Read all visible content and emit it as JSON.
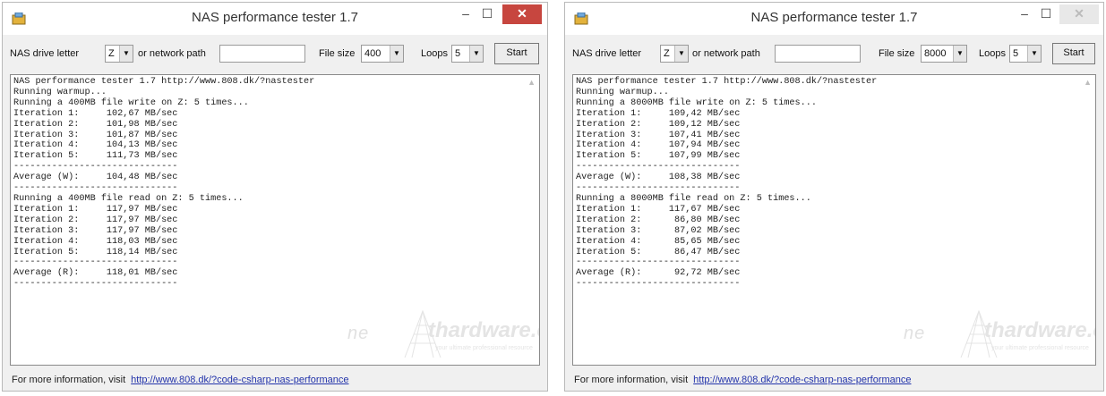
{
  "windows": [
    {
      "title": "NAS performance tester 1.7",
      "controls": {
        "minimize": "–",
        "maximize": "☐",
        "close": "✕"
      },
      "toolbar": {
        "drive_label": "NAS drive letter",
        "drive_value": "Z",
        "network_label": "or network path",
        "network_value": "",
        "filesize_label": "File size",
        "filesize_value": "400",
        "loops_label": "Loops",
        "loops_value": "5",
        "start_label": "Start"
      },
      "output": "NAS performance tester 1.7 http://www.808.dk/?nastester\nRunning warmup...\nRunning a 400MB file write on Z: 5 times...\nIteration 1:     102,67 MB/sec\nIteration 2:     101,98 MB/sec\nIteration 3:     101,87 MB/sec\nIteration 4:     104,13 MB/sec\nIteration 5:     111,73 MB/sec\n------------------------------\nAverage (W):     104,48 MB/sec\n------------------------------\nRunning a 400MB file read on Z: 5 times...\nIteration 1:     117,97 MB/sec\nIteration 2:     117,97 MB/sec\nIteration 3:     117,97 MB/sec\nIteration 4:     118,03 MB/sec\nIteration 5:     118,14 MB/sec\n------------------------------\nAverage (R):     118,01 MB/sec\n------------------------------",
      "footer": {
        "text": "For more information, visit",
        "link": "http://www.808.dk/?code-csharp-nas-performance"
      }
    },
    {
      "title": "NAS performance tester 1.7",
      "controls": {
        "minimize": "–",
        "maximize": "☐",
        "close": "✕"
      },
      "toolbar": {
        "drive_label": "NAS drive letter",
        "drive_value": "Z",
        "network_label": "or network path",
        "network_value": "",
        "filesize_label": "File size",
        "filesize_value": "8000",
        "loops_label": "Loops",
        "loops_value": "5",
        "start_label": "Start"
      },
      "output": "NAS performance tester 1.7 http://www.808.dk/?nastester\nRunning warmup...\nRunning a 8000MB file write on Z: 5 times...\nIteration 1:     109,42 MB/sec\nIteration 2:     109,12 MB/sec\nIteration 3:     107,41 MB/sec\nIteration 4:     107,94 MB/sec\nIteration 5:     107,99 MB/sec\n------------------------------\nAverage (W):     108,38 MB/sec\n------------------------------\nRunning a 8000MB file read on Z: 5 times...\nIteration 1:     117,67 MB/sec\nIteration 2:      86,80 MB/sec\nIteration 3:      87,02 MB/sec\nIteration 4:      85,65 MB/sec\nIteration 5:      86,47 MB/sec\n------------------------------\nAverage (R):      92,72 MB/sec\n------------------------------",
      "footer": {
        "text": "For more information, visit",
        "link": "http://www.808.dk/?code-csharp-nas-performance"
      }
    }
  ],
  "watermark": {
    "part1": "ne",
    "part2": "thardware.com",
    "tagline": "your ultimate professional resource"
  },
  "colors": {
    "close_active": "#c7463f",
    "link": "#2233aa"
  },
  "icons": {
    "app": "app-icon",
    "dropdown": "chevron-down-icon",
    "scroll": "scroll-up-arrow-icon"
  }
}
